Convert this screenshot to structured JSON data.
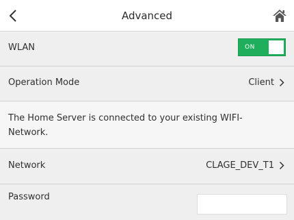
{
  "header": {
    "back_icon": "chevron-left-icon",
    "title": "Advanced",
    "home_icon": "home-icon"
  },
  "rows": {
    "wlan": {
      "label": "WLAN",
      "toggle_text": "ON",
      "toggle_state": true,
      "toggle_color": "#1fae5b"
    },
    "operation_mode": {
      "label": "Operation Mode",
      "value": "Client"
    },
    "info": {
      "text": "The Home Server is connected to your existing WIFI-Network."
    },
    "network": {
      "label": "Network",
      "value": "CLAGE_DEV_T1"
    },
    "password": {
      "label": "Password",
      "value": ""
    }
  }
}
